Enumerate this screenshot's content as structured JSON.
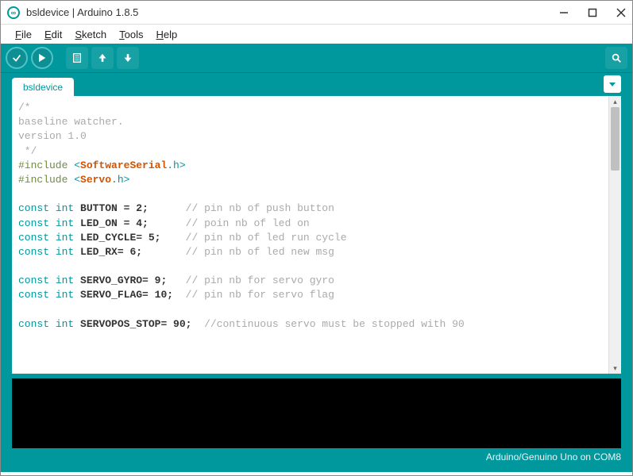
{
  "window": {
    "title": "bsldevice | Arduino 1.8.5"
  },
  "menu": {
    "file": "File",
    "edit": "Edit",
    "sketch": "Sketch",
    "tools": "Tools",
    "help": "Help"
  },
  "tabs": {
    "active": "bsldevice"
  },
  "code": {
    "l1": "/*",
    "l2": "baseline watcher.",
    "l3": "version 1.0",
    "l4": " */",
    "l5a": "#include",
    "l5b": " <",
    "l5c": "SoftwareSerial",
    "l5d": ".h>",
    "l6a": "#include",
    "l6b": " <",
    "l6c": "Servo",
    "l6d": ".h>",
    "kw_const": "const",
    "kw_int": "int",
    "r1_name": " BUTTON = 2;",
    "r1_cmt": "      // pin nb of push button",
    "r2_name": " LED_ON = 4;",
    "r2_cmt": "      // poin nb of led on",
    "r3_name": " LED_CYCLE= 5;",
    "r3_cmt": "    // pin nb of led run cycle",
    "r4_name": " LED_RX= 6;",
    "r4_cmt": "       // pin nb of led new msg",
    "r5_name": " SERVO_GYRO= 9;",
    "r5_cmt": "   // pin nb for servo gyro",
    "r6_name": " SERVO_FLAG= 10;",
    "r6_cmt": "  // pin nb for servo flag",
    "r7_name": " SERVOPOS_STOP= 90;",
    "r7_cmt": "  //continuous servo must be stopped with 90"
  },
  "footer": {
    "status": "Arduino/Genuino Uno on COM8"
  }
}
